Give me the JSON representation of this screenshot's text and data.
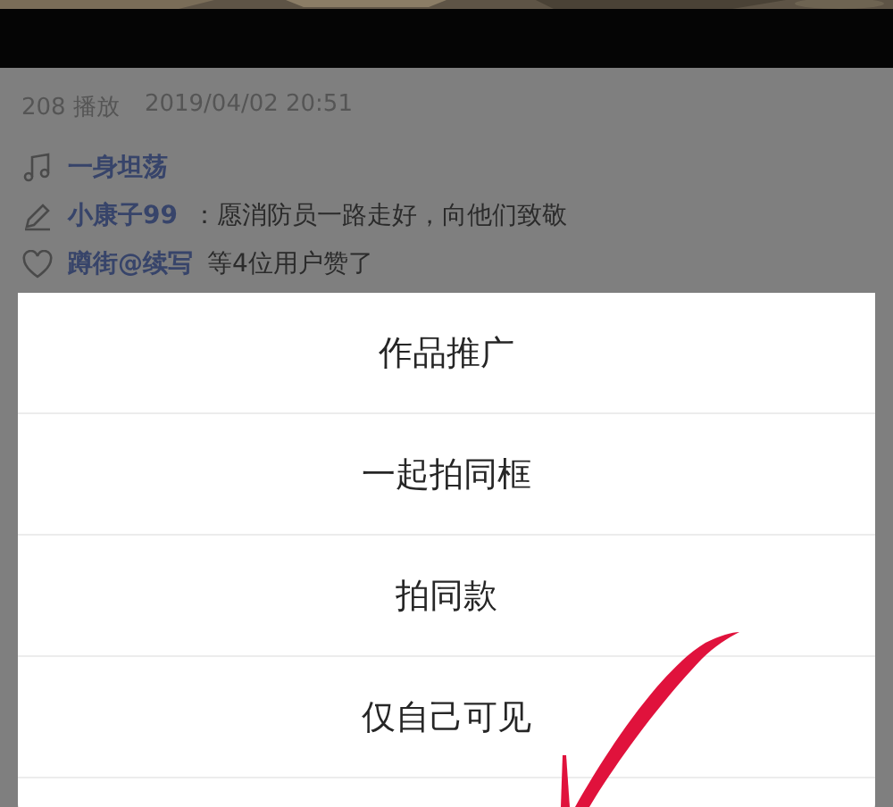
{
  "meta": {
    "plays": "208 播放",
    "date": "2019/04/02 20:51"
  },
  "info_rows": [
    {
      "kind": "music",
      "name": "一身坦荡",
      "text": ""
    },
    {
      "kind": "caption",
      "name": "小康子99",
      "text": "：愿消防员一路走好，向他们致敬"
    },
    {
      "kind": "likes",
      "name": "蹲街@续写",
      "text": " 等4位用户赞了"
    }
  ],
  "action_sheet": {
    "items": [
      "作品推广",
      "一起拍同框",
      "拍同款",
      "仅自己可见"
    ]
  },
  "annotation": {
    "kind": "check-mark"
  }
}
